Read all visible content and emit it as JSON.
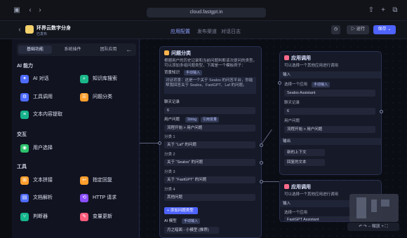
{
  "browser": {
    "url": "cloud.fastgpt.in"
  },
  "app": {
    "name": "环界云数字分身",
    "status": "已发布",
    "tabs": [
      "应用配置",
      "发布渠道",
      "对话日志"
    ],
    "run_label": "运行",
    "save_label": "保存"
  },
  "panel": {
    "tabs": [
      "基础功能",
      "系统插件",
      "团队应用"
    ],
    "sections": [
      {
        "title": "AI 能力",
        "items": [
          "AI 对话",
          "知识库搜索",
          "工具调用",
          "问题分类",
          "文本内容提取"
        ]
      },
      {
        "title": "交互",
        "items": [
          "用户选择"
        ]
      },
      {
        "title": "工具",
        "items": [
          "文本拼接",
          "指定回复",
          "文档解析",
          "HTTP 请求",
          "判断器",
          "变量更新"
        ]
      }
    ]
  },
  "node_qc": {
    "title": "问题分类",
    "desc": "根据用户的历史记录和当前问题判断该次提问的类型。可以添加多组问题类型，下面是一个模板例子：",
    "bg_label": "背景知识",
    "bg_text": "对话背景：这是一个关于 Sealos 的问答平台，你能帮我回答关于 Sealos、FastGPT、Laf 的问题。",
    "tags": [
      "手动输入",
      "String",
      "引用变量"
    ],
    "model": "AI 模型",
    "history": "聊天记录",
    "history_value": "6",
    "input_label": "用户问题",
    "input_value": "流程开始 > 用户问题",
    "class_label": "分类",
    "classes": [
      "关于 “Laf” 的问题",
      "关于 “Sealos” 的问题",
      "关于 “FastGPT” 的问题",
      "其他问题"
    ],
    "add_label": "添加问题类型",
    "model_value": "月之暗面 - 小模型 (推荐)"
  },
  "node_app1": {
    "title": "应用调用",
    "desc": "可以选择一个其他应用进行调用",
    "input_label": "输入",
    "selected_app_label": "选择一个应用",
    "app": "Sealos Assistant",
    "history_label": "聊天记录",
    "history_value": "6",
    "user_label": "用户问题",
    "user_value": "流程开始 > 用户问题",
    "output_label": "输出",
    "outputs": [
      "新的上下文",
      "回复的文本"
    ]
  },
  "node_app2": {
    "title": "应用调用",
    "desc": "可以选择一个其他应用进行调用",
    "input_label": "输入",
    "selected_app_label": "选择一个应用",
    "app": "FastGPT Assistant"
  },
  "controls": {
    "zoom": "缩放"
  }
}
